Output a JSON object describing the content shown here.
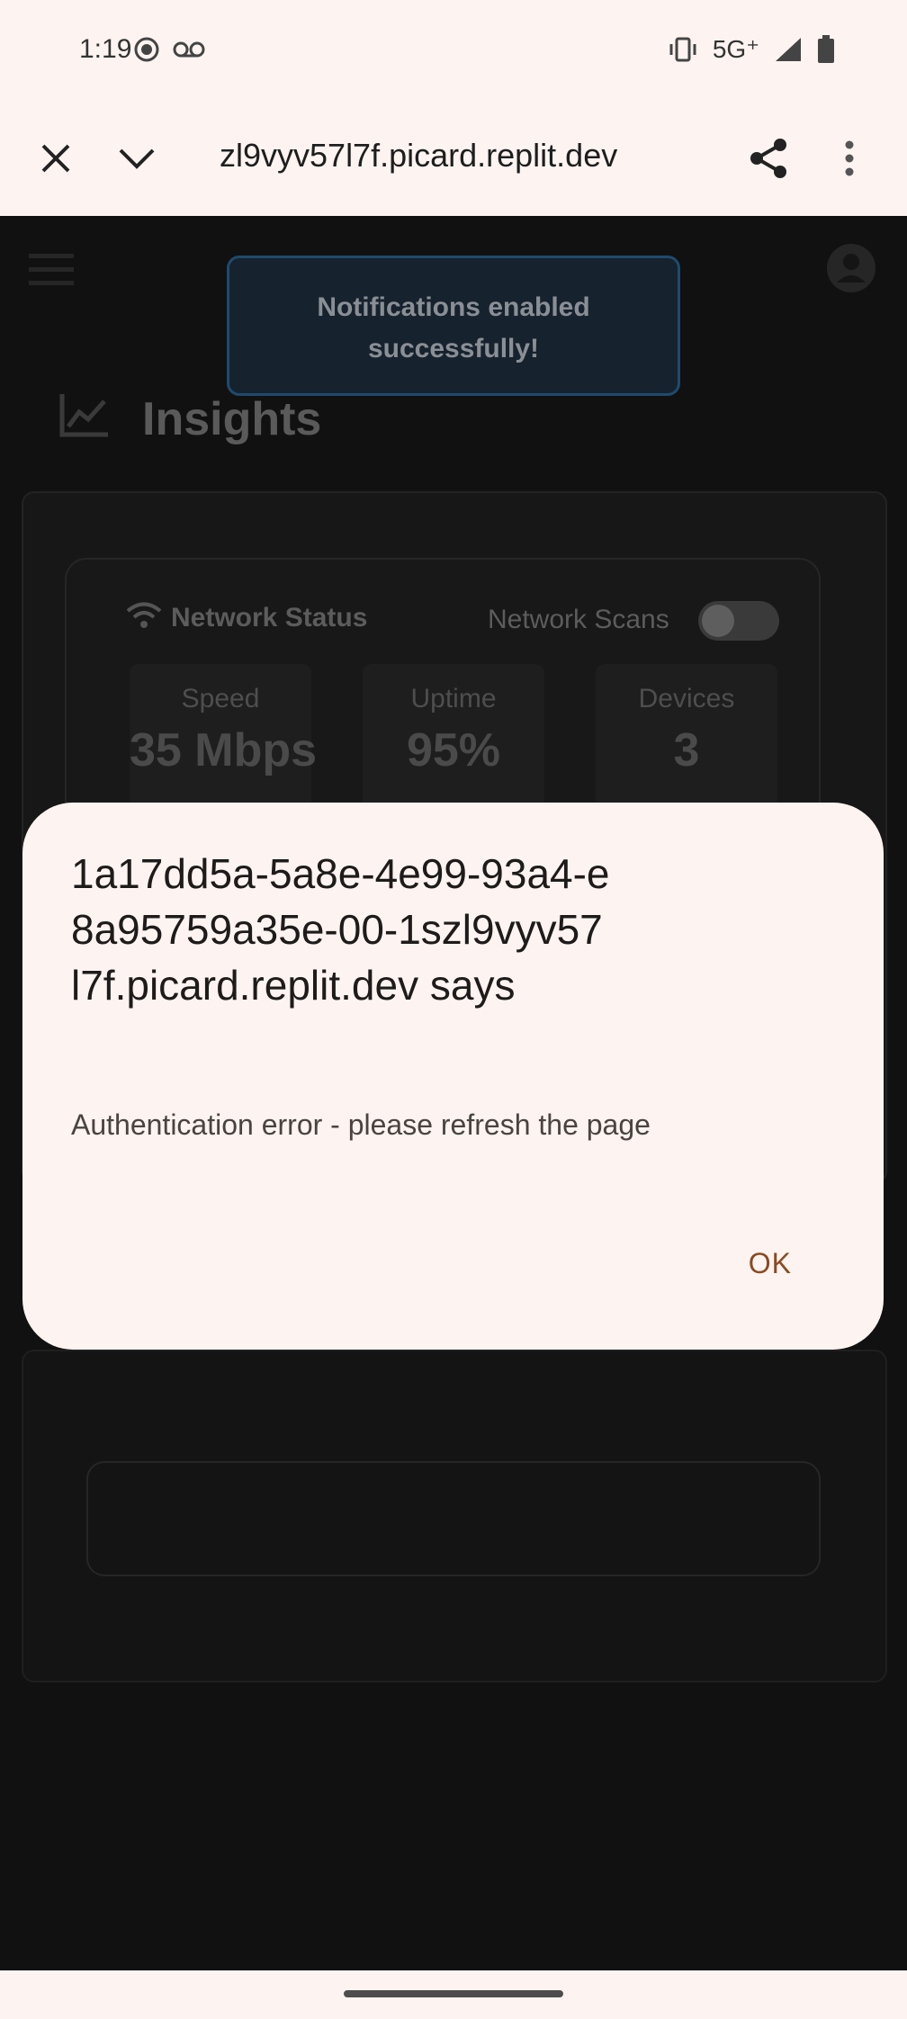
{
  "status_bar": {
    "time": "1:19",
    "network": "5G⁺"
  },
  "browser": {
    "url": "zl9vyv57l7f.picard.replit.dev"
  },
  "page": {
    "toast": "Notifications enabled successfully!",
    "title": "Insights",
    "network_status": {
      "title": "Network Status",
      "scans_label": "Network Scans",
      "scans_enabled": false,
      "stats": [
        {
          "label": "Speed",
          "value": "35 Mbps"
        },
        {
          "label": "Uptime",
          "value": "95%"
        },
        {
          "label": "Devices",
          "value": "3"
        }
      ]
    }
  },
  "dialog": {
    "title": "1a17dd5a-5a8e-4e99-93a4-e8a95759a35e-00-1szl9vyv57l7f.picard.replit.dev says",
    "message": "Authentication error - please refresh the page",
    "ok_label": "OK"
  },
  "colors": {
    "chrome_bg": "#fdf4f1",
    "dialog_button": "#8c4a20",
    "page_bg": "#111111"
  }
}
